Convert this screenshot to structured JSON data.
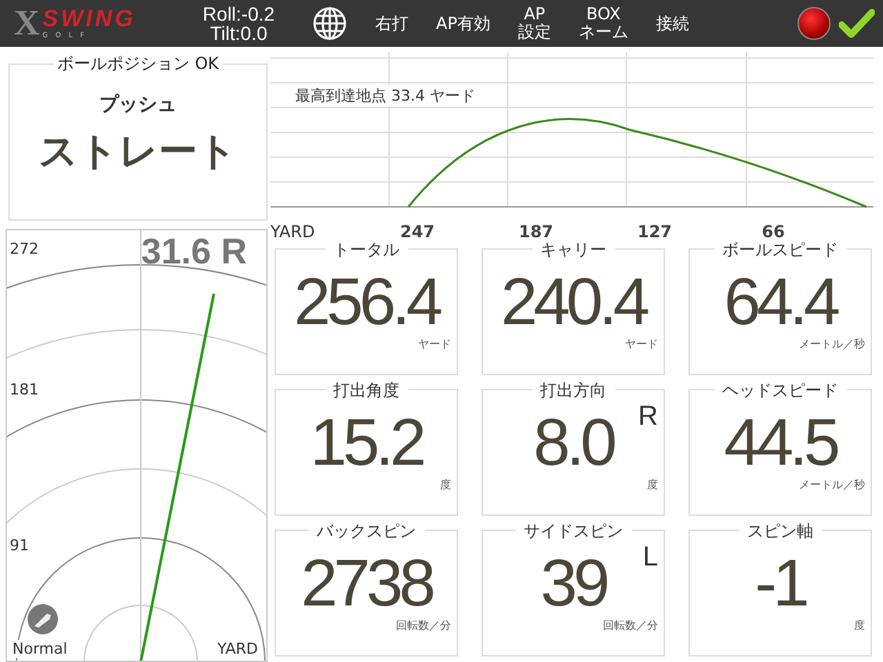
{
  "top_bar": {
    "logo": {
      "letter": "X",
      "word": "SWING",
      "sub": "G O L F"
    },
    "roll": "Roll:-0.2",
    "tilt": "Tilt:0.0",
    "buttons": [
      {
        "lines": [
          "右打"
        ]
      },
      {
        "lines": [
          "AP有効"
        ]
      },
      {
        "lines": [
          "AP",
          "設定"
        ]
      },
      {
        "lines": [
          "BOX",
          "ネーム"
        ]
      },
      {
        "lines": [
          "接続"
        ]
      }
    ],
    "connected": true,
    "ready": true
  },
  "ball_position": {
    "title": "ボールポジション  OK",
    "shape": "プッシュ",
    "direction": "ストレート"
  },
  "trajectory": {
    "apex": "最高到達地点 33.4 ヤード",
    "unit": "YARD",
    "x_labels": [
      "247",
      "187",
      "127",
      "66"
    ]
  },
  "dispersion": {
    "offline": "31.6 R",
    "distance_labels": [
      "272",
      "181",
      "91"
    ],
    "club": "Normal",
    "unit": "YARD"
  },
  "stats": [
    {
      "title": "トータル",
      "value": "256.4",
      "unit": "ヤード"
    },
    {
      "title": "キャリー",
      "value": "240.4",
      "unit": "ヤード"
    },
    {
      "title": "ボールスピード",
      "value": "64.4",
      "unit": "メートル／秒"
    },
    {
      "title": "打出角度",
      "value": "15.2",
      "unit": "度"
    },
    {
      "title": "打出方向",
      "value": "8.0",
      "unit": "度",
      "side": "R"
    },
    {
      "title": "ヘッドスピード",
      "value": "44.5",
      "unit": "メートル／秒"
    },
    {
      "title": "バックスピン",
      "value": "2738",
      "unit": "回転数／分"
    },
    {
      "title": "サイドスピン",
      "value": "39",
      "unit": "回転数／分",
      "side": "L"
    },
    {
      "title": "スピン軸",
      "value": "-1",
      "unit": "度"
    }
  ]
}
